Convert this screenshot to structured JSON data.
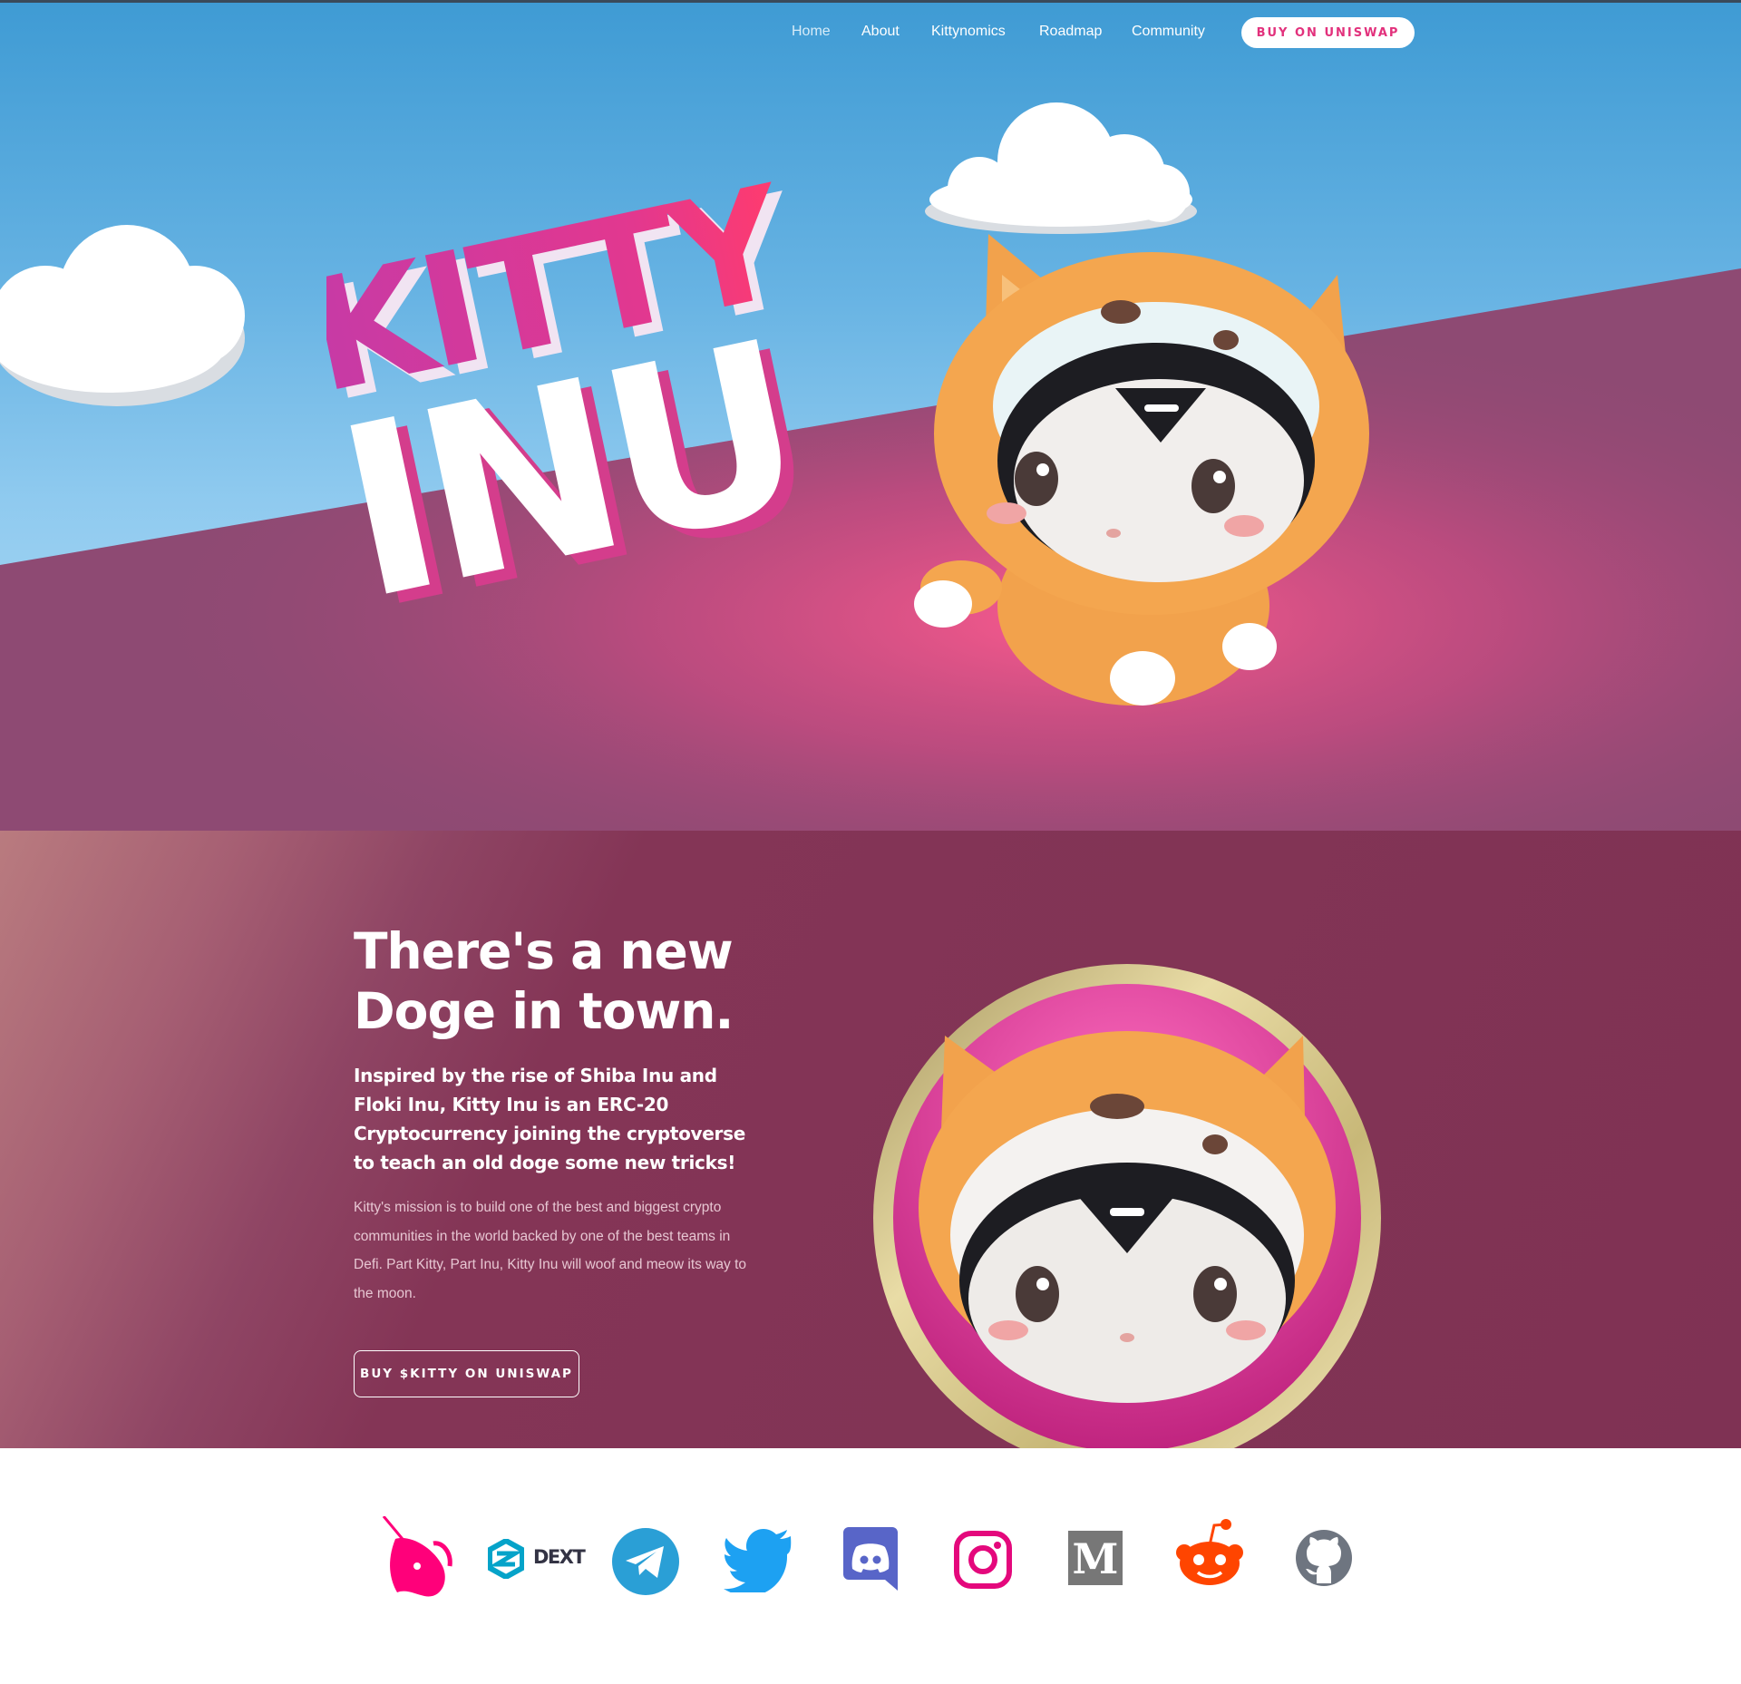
{
  "nav": {
    "items": [
      {
        "label": "Home"
      },
      {
        "label": "About"
      },
      {
        "label": "Kittynomics"
      },
      {
        "label": "Roadmap"
      },
      {
        "label": "Community"
      }
    ],
    "cta_label": "BUY ON UNISWAP"
  },
  "hero": {
    "logo_line1": "KITTY",
    "logo_line2": "INU"
  },
  "about": {
    "title": "There's a new Doge in town.",
    "lead": "Inspired by the rise of Shiba Inu and Floki Inu, Kitty Inu is an ERC-20 Cryptocurrency joining the cryptoverse to teach an old doge some new tricks!",
    "body": "Kitty's mission is to build one of the best and biggest crypto communities in the world backed by one of the best teams in Defi. Part Kitty, Part Inu, Kitty Inu will woof and meow its way to the moon.",
    "button_label": "BUY $KITTY ON UNISWAP"
  },
  "social": {
    "dext_label": "DEXT",
    "icons": [
      "uniswap-icon",
      "dextools-icon",
      "telegram-icon",
      "twitter-icon",
      "discord-icon",
      "instagram-icon",
      "medium-icon",
      "reddit-icon",
      "github-icon"
    ]
  },
  "colors": {
    "sky": "#4aa3d9",
    "ground": "#8e4a73",
    "about_bg": "#7f3254",
    "accent_pink": "#e2317c",
    "telegram": "#2a9fd6",
    "twitter": "#1da1f2",
    "discord": "#5865c8",
    "instagram": "#e4087c",
    "medium": "#777777",
    "reddit": "#ff4500",
    "github": "#6e7580"
  }
}
